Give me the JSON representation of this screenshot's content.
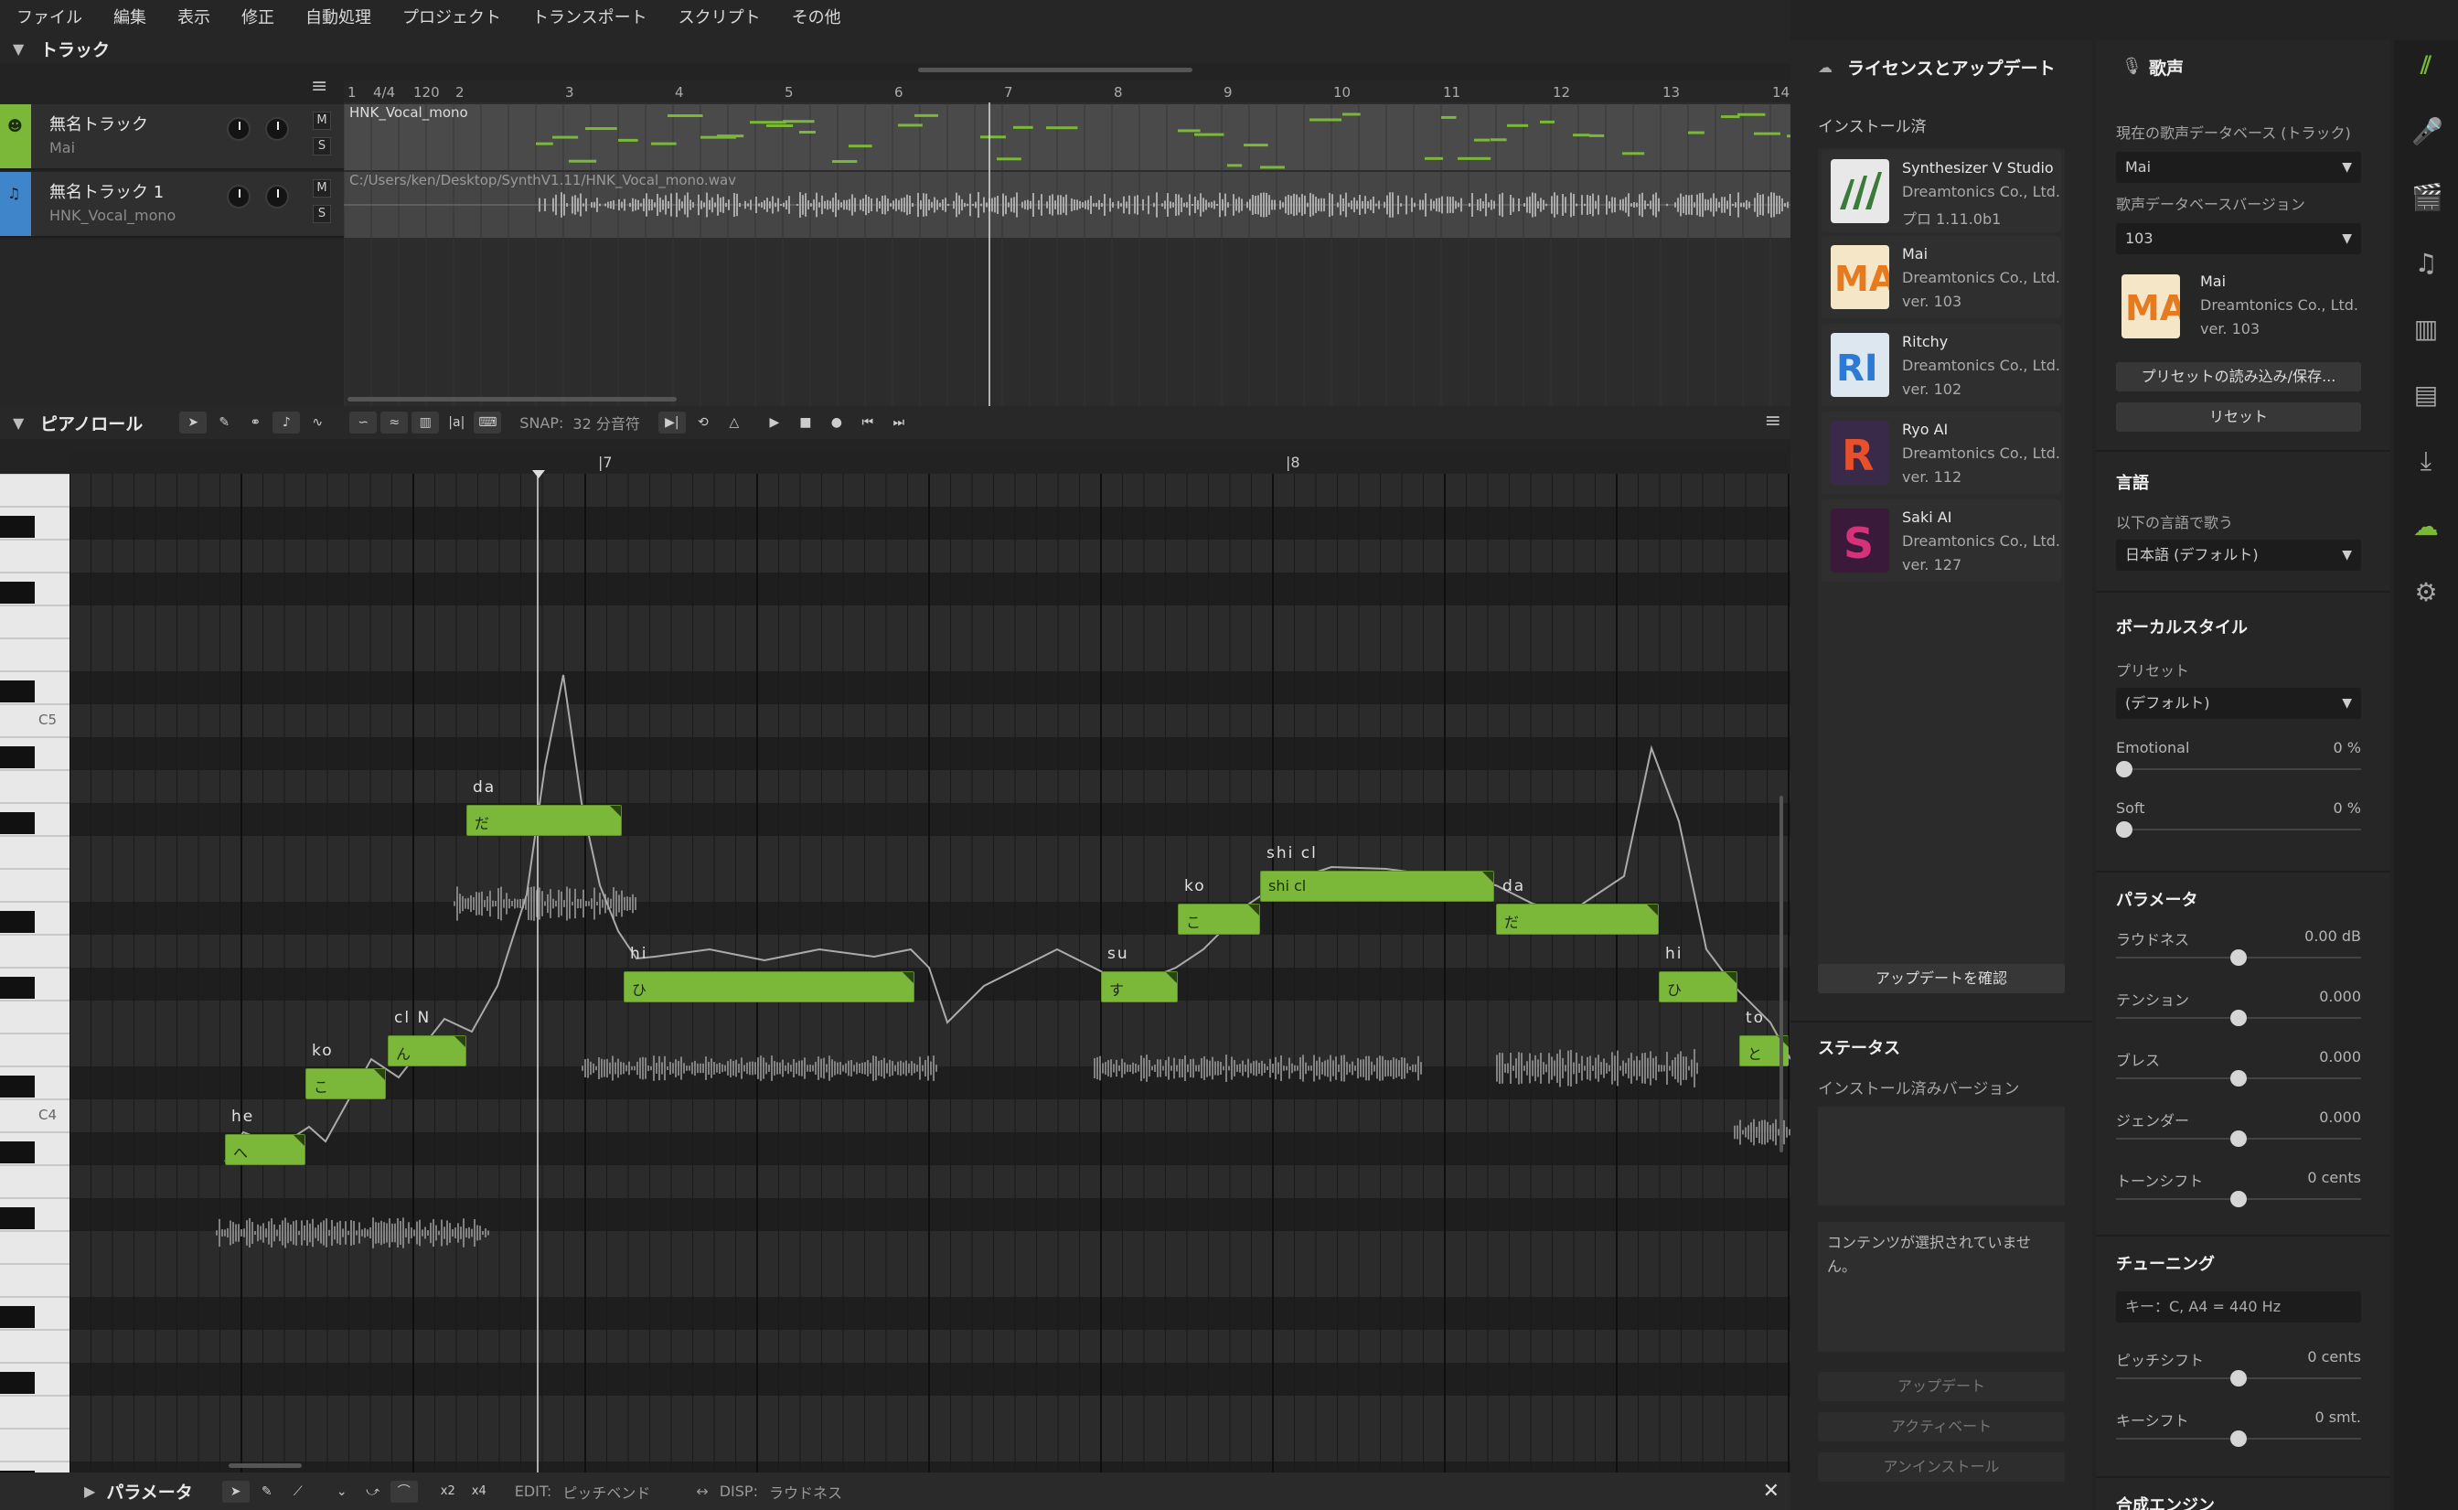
{
  "menu": [
    "ファイル",
    "編集",
    "表示",
    "修正",
    "自動処理",
    "プロジェクト",
    "トランスポート",
    "スクリプト",
    "その他"
  ],
  "tracks_panel": {
    "title": "トラック",
    "tempo": "120",
    "timesig": "4/4",
    "tracks": [
      {
        "name": "無名トラック",
        "sub": "Mai",
        "clip": "HNK_Vocal_mono"
      },
      {
        "name": "無名トラック 1",
        "sub": "HNK_Vocal_mono",
        "clip": "C:/Users/ken/Desktop/SynthV1.11/HNK_Vocal_mono.wav"
      }
    ],
    "ruler": [
      "1",
      "2",
      "3",
      "4",
      "5",
      "6",
      "7",
      "8",
      "9",
      "10",
      "11",
      "12",
      "13",
      "14"
    ],
    "m_label": "M",
    "s_label": "S"
  },
  "piano_roll": {
    "title": "ピアノロール",
    "snap_label": "SNAP:",
    "snap_value": "32 分音符",
    "measure_labels": [
      "7",
      "8"
    ],
    "keys": [
      "C5",
      "C4"
    ],
    "notes": [
      {
        "ph": "he",
        "lyric": "へ"
      },
      {
        "ph": "ko",
        "lyric": "こ"
      },
      {
        "ph": "cl N",
        "lyric": "ん"
      },
      {
        "ph": "da",
        "lyric": "だ"
      },
      {
        "ph": "hi",
        "lyric": "ひ"
      },
      {
        "ph": "su",
        "lyric": "す"
      },
      {
        "ph": "ko",
        "lyric": "こ"
      },
      {
        "ph": "shi cl",
        "lyric": "shi cl"
      },
      {
        "ph": "da",
        "lyric": "だ"
      },
      {
        "ph": "hi",
        "lyric": "ひ"
      },
      {
        "ph": "to",
        "lyric": "と"
      }
    ]
  },
  "param_bar": {
    "title": "パラメータ",
    "edit_label": "EDIT:",
    "edit_value": "ピッチベンド",
    "disp_label": "DISP:",
    "disp_value": "ラウドネス",
    "x2": "x2",
    "x4": "x4"
  },
  "license": {
    "title": "ライセンスとアップデート",
    "installed": "インストール済",
    "items": [
      {
        "name": "Synthesizer V Studio",
        "vendor": "Dreamtonics Co., Ltd.",
        "ver": "プロ 1.11.0b1"
      },
      {
        "name": "Mai",
        "vendor": "Dreamtonics Co., Ltd.",
        "ver": "ver. 103"
      },
      {
        "name": "Ritchy",
        "vendor": "Dreamtonics Co., Ltd.",
        "ver": "ver. 102"
      },
      {
        "name": "Ryo AI",
        "vendor": "Dreamtonics Co., Ltd.",
        "ver": "ver. 112"
      },
      {
        "name": "Saki AI",
        "vendor": "Dreamtonics Co., Ltd.",
        "ver": "ver. 127"
      }
    ],
    "check_update": "アップデートを確認",
    "status": "ステータス",
    "installed_version": "インストール済みバージョン",
    "no_content": "コンテンツが選択されていません。",
    "update": "アップデート",
    "activate": "アクティベート",
    "uninstall": "アンインストール"
  },
  "voice": {
    "title": "歌声",
    "db_label": "現在の歌声データベース (トラック)",
    "db_value": "Mai",
    "ver_label": "歌声データベースバージョン",
    "ver_value": "103",
    "card_name": "Mai",
    "card_vendor": "Dreamtonics Co., Ltd.",
    "card_ver": "ver. 103",
    "preset_btn": "プリセットの読み込み/保存...",
    "reset_btn": "リセット",
    "lang_title": "言語",
    "lang_label": "以下の言語で歌う",
    "lang_value": "日本語 (デフォルト)",
    "style_title": "ボーカルスタイル",
    "preset_label": "プリセット",
    "preset_value": "(デフォルト)",
    "emotional": "Emotional",
    "emotional_val": "0 %",
    "soft": "Soft",
    "soft_val": "0 %",
    "params_title": "パラメータ",
    "params": [
      {
        "n": "ラウドネス",
        "v": "0.00 dB"
      },
      {
        "n": "テンション",
        "v": "0.000"
      },
      {
        "n": "ブレス",
        "v": "0.000"
      },
      {
        "n": "ジェンダー",
        "v": "0.000"
      },
      {
        "n": "トーンシフト",
        "v": "0 cents"
      }
    ],
    "tuning_title": "チューニング",
    "key_value": "キー：C, A4 = 440 Hz",
    "pitch_shift": "ピッチシフト",
    "pitch_shift_val": "0 cents",
    "key_shift": "キーシフト",
    "key_shift_val": "0 smt.",
    "engine_title": "合成エンジン"
  },
  "colors": {
    "accent": "#7bb83a",
    "panel": "#262626",
    "background": "#232323"
  }
}
